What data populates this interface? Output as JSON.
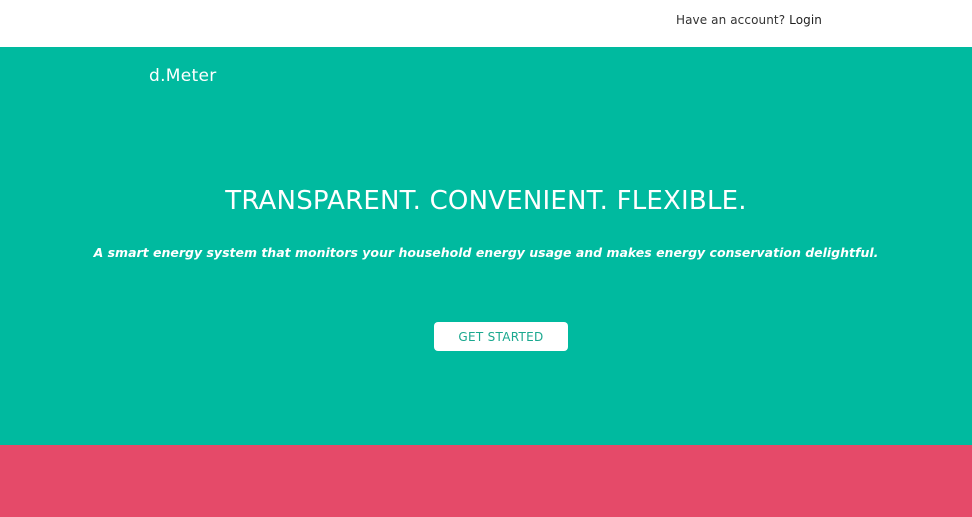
{
  "header": {
    "account_prompt": "Have an account?",
    "login_label": "Login"
  },
  "hero": {
    "brand": "d.Meter",
    "headline": "TRANSPARENT. CONVENIENT. FLEXIBLE.",
    "tagline": "A smart energy system that monitors your household energy usage and makes energy conservation delightful.",
    "cta_label": "GET STARTED"
  },
  "colors": {
    "hero_background": "#00BA9F",
    "band_background": "#E54A69",
    "topbar_background": "#FFFFFF"
  }
}
